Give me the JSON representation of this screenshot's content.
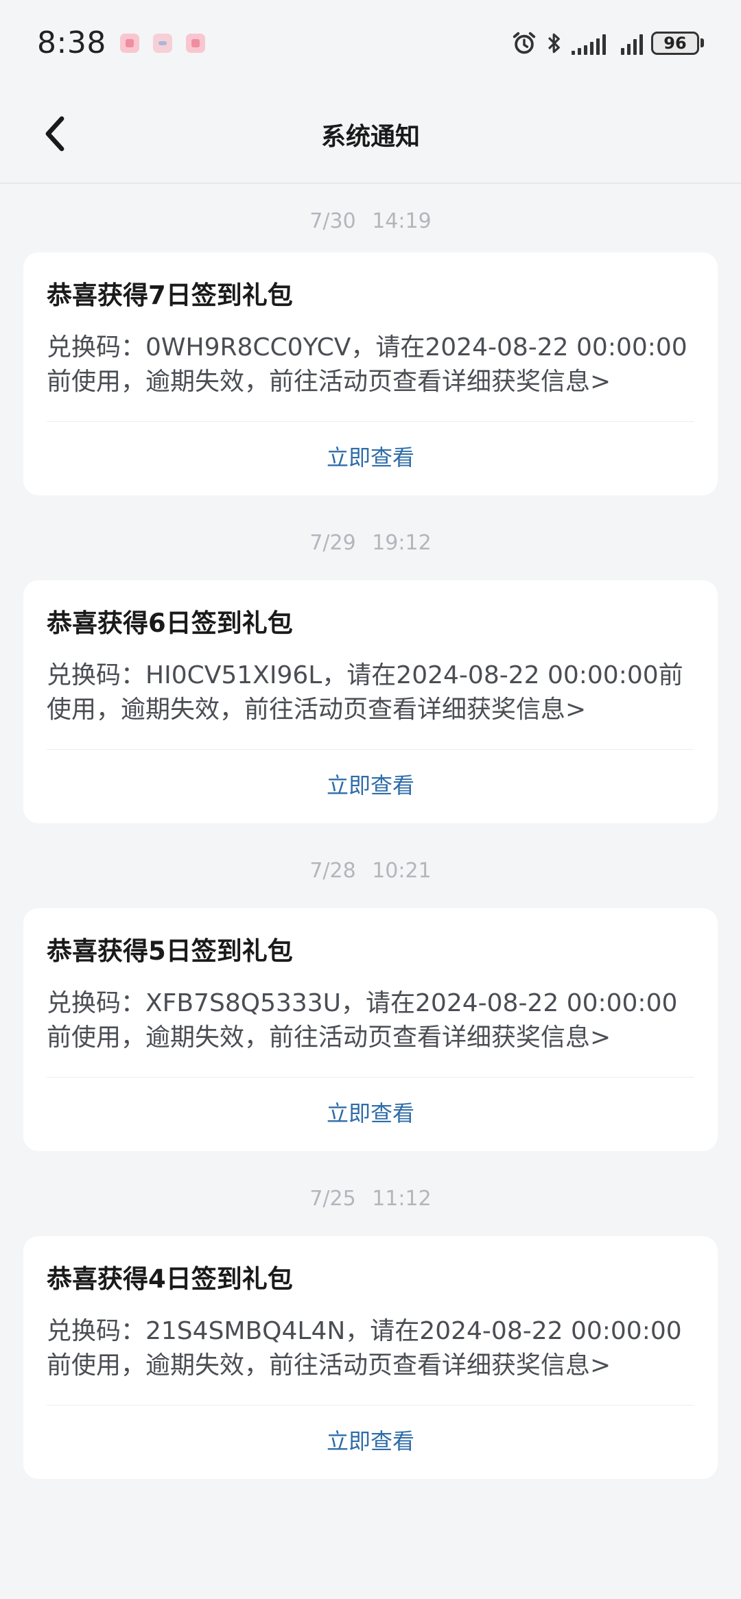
{
  "status_bar": {
    "time": "8:38",
    "battery": "96"
  },
  "header": {
    "title": "系统通知"
  },
  "notifications": [
    {
      "time": "7/30  14:19",
      "title": "恭喜获得7日签到礼包",
      "body": "兑换码：0WH9R8CC0YCV，请在2024-08-22 00:00:00前使用，逾期失效，前往活动页查看详细获奖信息>",
      "action": "立即查看"
    },
    {
      "time": "7/29  19:12",
      "title": "恭喜获得6日签到礼包",
      "body": "兑换码：HI0CV51XI96L，请在2024-08-22 00:00:00前使用，逾期失效，前往活动页查看详细获奖信息>",
      "action": "立即查看"
    },
    {
      "time": "7/28  10:21",
      "title": "恭喜获得5日签到礼包",
      "body": "兑换码：XFB7S8Q5333U，请在2024-08-22 00:00:00前使用，逾期失效，前往活动页查看详细获奖信息>",
      "action": "立即查看"
    },
    {
      "time": "7/25  11:12",
      "title": "恭喜获得4日签到礼包",
      "body": "兑换码：21S4SMBQ4L4N，请在2024-08-22 00:00:00前使用，逾期失效，前往活动页查看详细获奖信息>",
      "action": "立即查看"
    }
  ]
}
